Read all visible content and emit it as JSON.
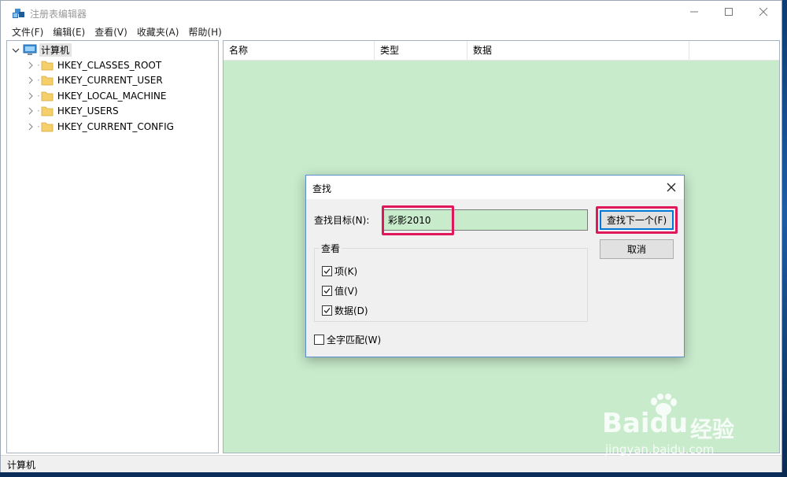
{
  "window": {
    "title": "注册表编辑器",
    "menu": [
      "文件(F)",
      "编辑(E)",
      "查看(V)",
      "收藏夹(A)",
      "帮助(H)"
    ]
  },
  "tree": {
    "root": "计算机",
    "items": [
      "HKEY_CLASSES_ROOT",
      "HKEY_CURRENT_USER",
      "HKEY_LOCAL_MACHINE",
      "HKEY_USERS",
      "HKEY_CURRENT_CONFIG"
    ]
  },
  "list": {
    "columns": [
      "名称",
      "类型",
      "数据"
    ]
  },
  "status": {
    "text": "计算机"
  },
  "find_dialog": {
    "title": "查找",
    "target_label": "查找目标(N):",
    "target_value": "彩影2010",
    "find_next_label": "查找下一个(F)",
    "cancel_label": "取消",
    "group_label": "查看",
    "options": [
      {
        "label": "项(K)",
        "checked": true
      },
      {
        "label": "值(V)",
        "checked": true
      },
      {
        "label": "数据(D)",
        "checked": true
      }
    ],
    "match_whole": {
      "label": "全字匹配(W)",
      "checked": false
    }
  },
  "watermark": {
    "brand": "Bai",
    "brand_tail": "du",
    "name": "经验",
    "url": "jingyan.baidu.com"
  },
  "colors": {
    "highlight": "#e0185a",
    "list_background": "#c8ebcc",
    "dialog_border": "#5c8fcf",
    "default_button": "#0078d7"
  }
}
